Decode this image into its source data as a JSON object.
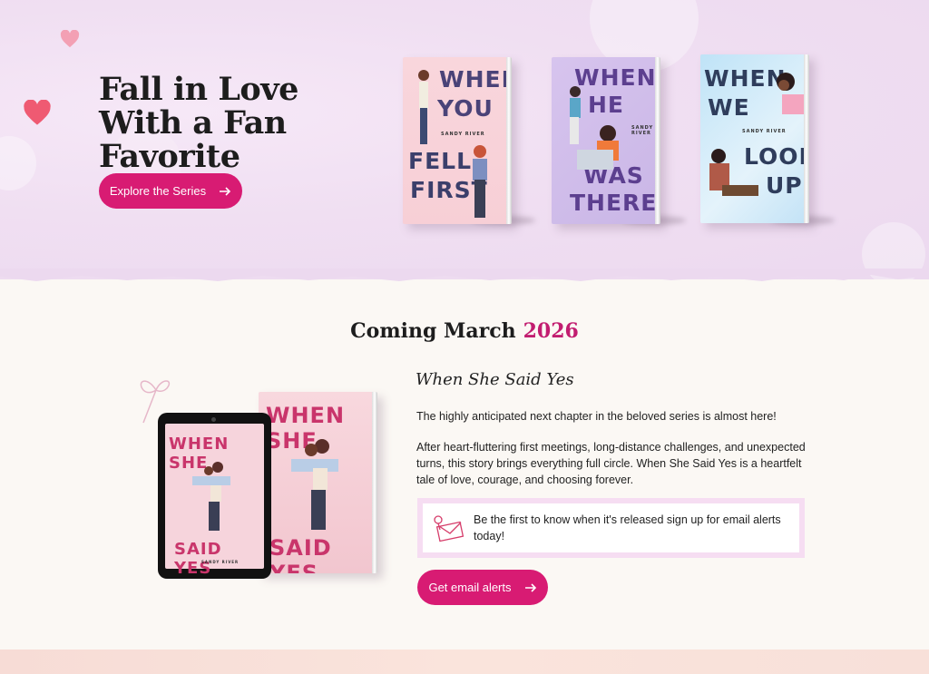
{
  "hero": {
    "title": "Fall in Love With a Fan Favorite",
    "button_label": "Explore the Series"
  },
  "books": [
    {
      "cover_text": [
        "WHEN",
        "YOU",
        "FELL",
        "FIRST"
      ],
      "author": "SANDY RIVER"
    },
    {
      "cover_text": [
        "WHEN",
        "HE",
        "WAS",
        "THERE"
      ],
      "author": "SANDY RIVER"
    },
    {
      "cover_text": [
        "WHEN",
        "WE",
        "LOOK",
        "UP"
      ],
      "author": "SANDY RIVER"
    }
  ],
  "coming": {
    "heading": "Coming March",
    "year": "2026",
    "book_title": "When She Said Yes",
    "cover_text_top": "WHEN SHE",
    "cover_text_bottom": "SAID YES",
    "author": "SANDY RIVER",
    "paragraph1": "The highly anticipated next chapter in the beloved series is almost here!",
    "paragraph2": "After heart-fluttering first meetings, long-distance challenges, and unexpected turns, this story brings everything full circle. When She Said Yes is a heartfelt tale of love, courage, and choosing forever.",
    "notice": "Be the first to know when it's released sign up for email alerts today!",
    "button_label": "Get email alerts"
  },
  "colors": {
    "accent": "#d81b73",
    "year": "#c21d70",
    "hero_bg": "#f0dff2",
    "section_bg": "#fbf8f4"
  }
}
